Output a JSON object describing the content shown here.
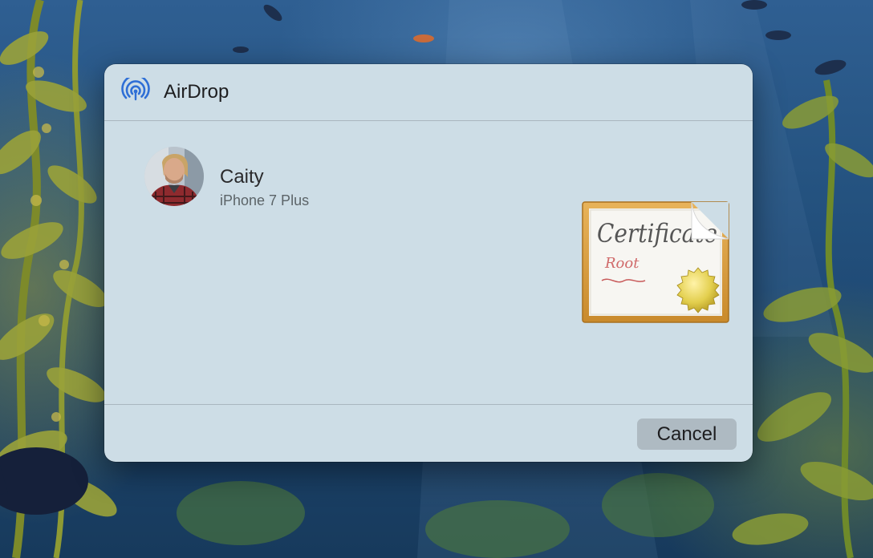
{
  "dialog": {
    "title": "AirDrop",
    "icon": "airdrop-icon",
    "accent_color": "#2f6fd6"
  },
  "recipients": [
    {
      "name": "Caity",
      "device": "iPhone 7 Plus",
      "avatar": "person-photo"
    }
  ],
  "shared_file": {
    "icon": "certificate-file-icon",
    "certificate_text": "Certificate",
    "certificate_subtext": "Root"
  },
  "footer": {
    "cancel_label": "Cancel"
  },
  "background": {
    "description_icon": "underwater-kelp-wallpaper"
  }
}
